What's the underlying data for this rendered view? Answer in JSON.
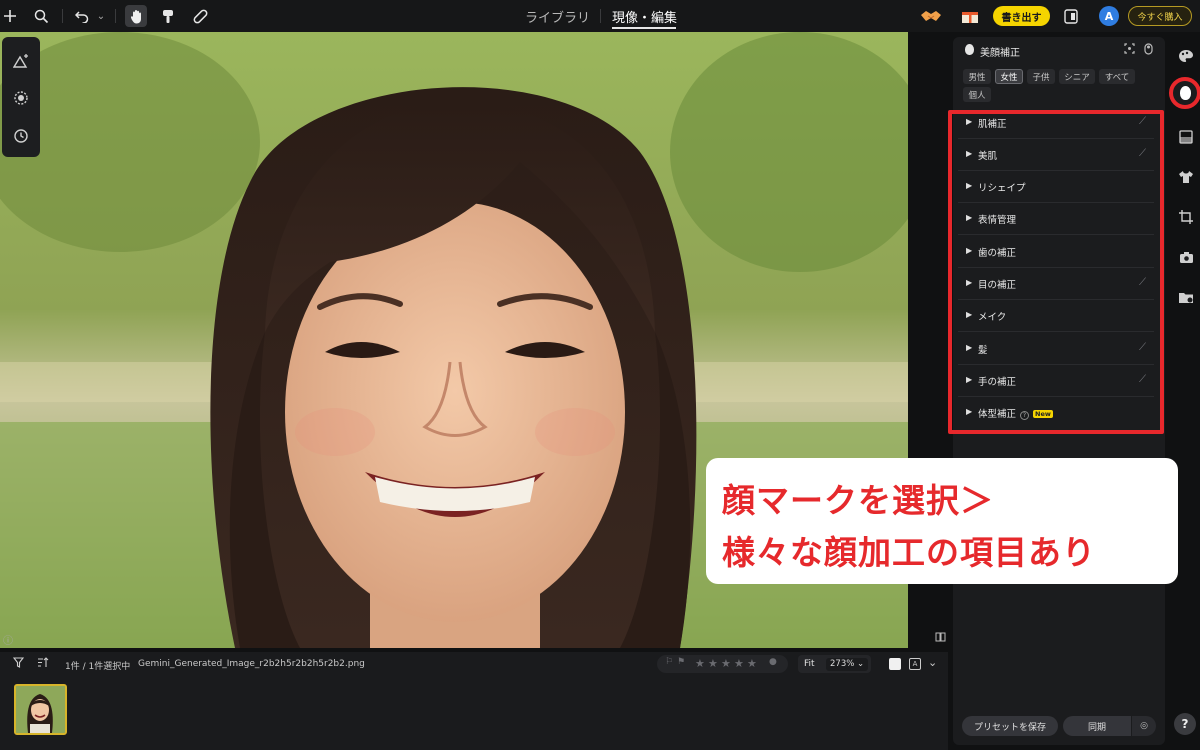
{
  "topbar": {
    "icons": [
      "plus-icon",
      "search-icon",
      "undo-icon",
      "chevron-down-icon",
      "hand-icon",
      "brush-icon",
      "bandage-icon"
    ],
    "tabs": [
      {
        "label": "ライブラリ"
      },
      {
        "label": "現像・編集"
      }
    ],
    "export_label": "書き出す",
    "avatar_letter": "A",
    "buy_label": "今すぐ購入"
  },
  "panel": {
    "title": "美顔補正",
    "chips": [
      "男性",
      "女性",
      "子供",
      "シニア",
      "すべて",
      "個人"
    ],
    "active_chip": "女性",
    "items": [
      {
        "label": "肌補正",
        "reset": true
      },
      {
        "label": "美肌",
        "reset": true
      },
      {
        "label": "リシェイプ",
        "reset": false
      },
      {
        "label": "表情管理",
        "reset": false
      },
      {
        "label": "歯の補正",
        "reset": false
      },
      {
        "label": "目の補正",
        "reset": true
      },
      {
        "label": "メイク",
        "reset": false
      },
      {
        "label": "髪",
        "reset": true
      },
      {
        "label": "手の補正",
        "reset": true
      },
      {
        "label": "体型補正",
        "reset": false,
        "badge": "New"
      }
    ],
    "preset_label": "プリセットを保存",
    "sync_label": "同期"
  },
  "callout": {
    "line1": "顔マークを選択＞",
    "line2": "様々な顔加工の項目あり"
  },
  "filmstrip": {
    "count": "1件 / 1件選択中",
    "filename": "Gemini_Generated_Image_r2b2h5r2b2h5r2b2.png",
    "rating": 0,
    "fit_label": "Fit",
    "zoom": "273%"
  },
  "colors": {
    "accent_yellow": "#f5d400",
    "annotation_red": "#e8282c",
    "panel_bg": "#1b1c1e"
  }
}
